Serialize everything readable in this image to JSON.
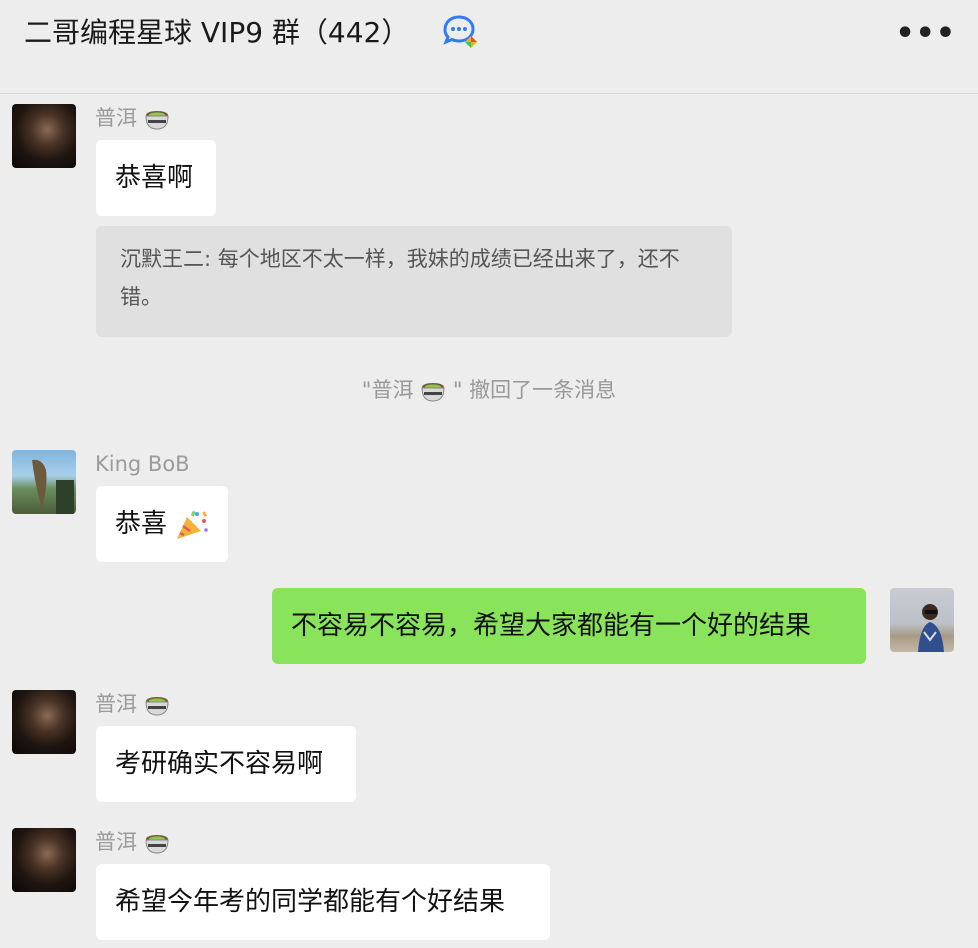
{
  "header": {
    "title": "二哥编程星球 VIP9 群（442）",
    "more_label": "•••"
  },
  "messages": [
    {
      "sender": "普洱",
      "text": "恭喜啊"
    },
    {
      "quote": "沉默王二: 每个地区不太一样，我妹的成绩已经出来了，还不错。"
    },
    {
      "system_prefix": "\"普洱",
      "system_suffix": "\" 撤回了一条消息"
    },
    {
      "sender": "King BoB",
      "text": "恭喜"
    },
    {
      "text": "不容易不容易，希望大家都能有一个好的结果"
    },
    {
      "sender": "普洱",
      "text": "考研确实不容易啊"
    },
    {
      "sender": "普洱",
      "text": "希望今年考的同学都能有个好结果"
    }
  ],
  "colors": {
    "self_bubble": "#89e35b",
    "other_bubble": "#ffffff",
    "background": "#ededed",
    "quote_bg": "#e0e0e0"
  },
  "icons": [
    "chat-bubbles-icon",
    "more-icon",
    "tea-pot-emoji",
    "party-popper-emoji"
  ]
}
